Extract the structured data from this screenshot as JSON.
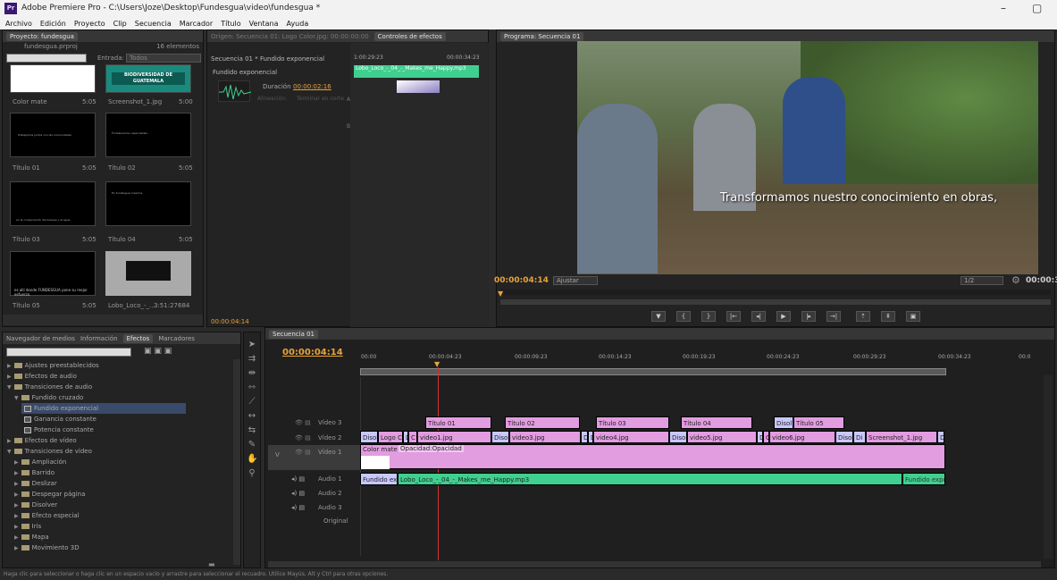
{
  "window": {
    "title": "Adobe Premiere Pro - C:\\Users\\Joze\\Desktop\\Fundesgua\\video\\fundesgua *",
    "minimize": "–",
    "maximize": "▢"
  },
  "menu": [
    "Archivo",
    "Edición",
    "Proyecto",
    "Clip",
    "Secuencia",
    "Marcador",
    "Título",
    "Ventana",
    "Ayuda"
  ],
  "project": {
    "tab": "Proyecto: fundesgua",
    "file": "fundesgua.prproj",
    "count": "16 elementos",
    "entrada_label": "Entrada:",
    "entrada_value": "Todos",
    "items": [
      {
        "name": "Color mate",
        "dur": "5:05",
        "thumb_text": ""
      },
      {
        "name": "Screenshot_1.jpg",
        "dur": "5:00",
        "thumb_text": "BIODIVERSIDAD DE GUATEMALA"
      },
      {
        "name": "Título 01",
        "dur": "5:05",
        "thumb_text": "Trabajamos juntos con las comunidades"
      },
      {
        "name": "Título 02",
        "dur": "5:05",
        "thumb_text": "Fortalecemos capacidades"
      },
      {
        "name": "Título 03",
        "dur": "5:05",
        "thumb_text": "en la conservación del bosque y el agua"
      },
      {
        "name": "Título 04",
        "dur": "5:05",
        "thumb_text": "En fundesgua creemos"
      },
      {
        "name": "Título 05",
        "dur": "5:05",
        "thumb_text": "es allí donde FUNDESGUA pone su mejor esfuerzo."
      },
      {
        "name": "Lobo_Loco_-_...",
        "dur": "3:51:27684",
        "thumb_text": ""
      }
    ]
  },
  "source": {
    "tab": "Origen: Secuencia 01: Logo Color.jpg: 00:00:00:00"
  },
  "effect_controls": {
    "tab": "Controles de efectos",
    "seq": "Secuencia 01 * Fundido exponencial",
    "effect": "Fundido exponencial",
    "duration_label": "Duración",
    "duration_value": "00:00:02:16",
    "align_label": "Alineación:",
    "align_value": "Terminar en corte",
    "t1": "1:00:29:23",
    "t2": "00:00:34:23",
    "clip": "Lobo_Loco_-_04_-_Makes_me_Happy.mp3",
    "side_a": "A",
    "side_b": "B",
    "footer_tc": "00:00:04:14"
  },
  "program": {
    "tab": "Programa: Secuencia 01",
    "subtitle": "Transformamos nuestro conocimiento en obras,",
    "timecode": "00:00:04:14",
    "fit": "Ajustar",
    "zoom": "1/2",
    "end_tc": "00:00:3"
  },
  "effects_panel": {
    "tabs": [
      "Navegador de medios",
      "Información",
      "Efectos",
      "Marcadores"
    ],
    "tree": [
      {
        "label": "Ajustes preestablecidos",
        "level": 0,
        "type": "folder"
      },
      {
        "label": "Efectos de audio",
        "level": 0,
        "type": "folder"
      },
      {
        "label": "Transiciones de audio",
        "level": 0,
        "type": "folder",
        "open": true
      },
      {
        "label": "Fundido cruzado",
        "level": 1,
        "type": "folder",
        "open": true
      },
      {
        "label": "Fundido exponencial",
        "level": 2,
        "type": "fx",
        "selected": true
      },
      {
        "label": "Ganancia constante",
        "level": 2,
        "type": "fx"
      },
      {
        "label": "Potencia constante",
        "level": 2,
        "type": "fx"
      },
      {
        "label": "Efectos de vídeo",
        "level": 0,
        "type": "folder"
      },
      {
        "label": "Transiciones de vídeo",
        "level": 0,
        "type": "folder",
        "open": true
      },
      {
        "label": "Ampliación",
        "level": 1,
        "type": "folder"
      },
      {
        "label": "Barrido",
        "level": 1,
        "type": "folder"
      },
      {
        "label": "Deslizar",
        "level": 1,
        "type": "folder"
      },
      {
        "label": "Despegar página",
        "level": 1,
        "type": "folder"
      },
      {
        "label": "Disolver",
        "level": 1,
        "type": "folder"
      },
      {
        "label": "Efecto especial",
        "level": 1,
        "type": "folder"
      },
      {
        "label": "Iris",
        "level": 1,
        "type": "folder"
      },
      {
        "label": "Mapa",
        "level": 1,
        "type": "folder"
      },
      {
        "label": "Movimiento 3D",
        "level": 1,
        "type": "folder"
      }
    ]
  },
  "timeline": {
    "tab": "Secuencia 01",
    "timecode": "00:00:04:14",
    "ruler": [
      "00:00",
      "00:00:04:23",
      "00:00:09:23",
      "00:00:14:23",
      "00:00:19:23",
      "00:00:24:23",
      "00:00:29:23",
      "00:00:34:23",
      "00:0"
    ],
    "tracks": [
      "Vídeo 3",
      "Vídeo 2",
      "Vídeo 1",
      "Audio 1",
      "Audio 2",
      "Audio 3",
      "Original"
    ],
    "v3": [
      "Título 01",
      "Título 02",
      "Título 03",
      "Título 04",
      "Disol",
      "Título 05"
    ],
    "v2": [
      "Disol",
      "Logo C",
      "D",
      "C",
      "video1.jpg",
      "Disol",
      "video3.jpg",
      "D",
      "D",
      "video4.jpg",
      "Disol",
      "video5.jpg",
      "D",
      "C",
      "video6.jpg",
      "Disol",
      "Di",
      "Screenshot_1.jpg",
      "D"
    ],
    "v1": {
      "clip": "Color mate",
      "fx": "Opacidad:Opacidad"
    },
    "a1": {
      "fade_in": "Fundido exp",
      "clip": "Lobo_Loco_-_04_-_Makes_me_Happy.mp3",
      "fade_out": "Fundido expon"
    }
  },
  "status": "Haga clic para seleccionar o haga clic en un espacio vacío y arrastre para seleccionar el recuadro. Utilice Mayús, Alt y Ctrl para otras opciones.",
  "colors": {
    "accent": "#e8a33a",
    "video_clip": "#e29ce0",
    "audio_clip": "#3fcf8f",
    "playhead": "#d83030"
  }
}
